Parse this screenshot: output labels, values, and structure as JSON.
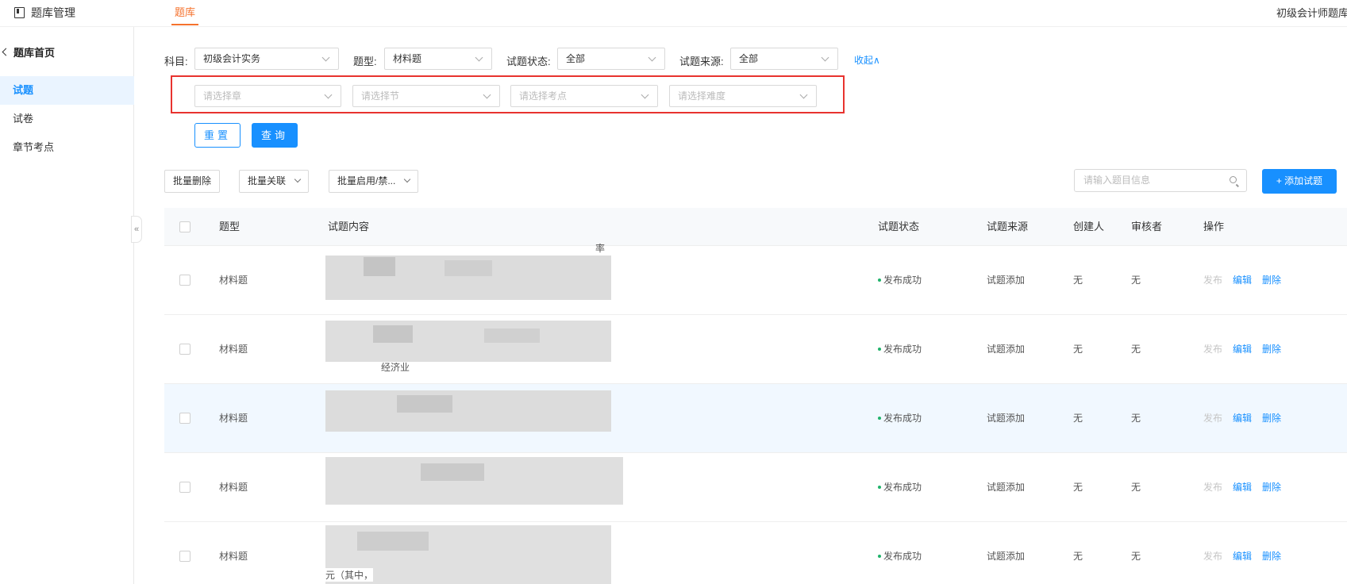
{
  "header": {
    "app_title": "题库管理",
    "active_tab": "题库",
    "right_text": "初级会计师题库"
  },
  "sidebar": {
    "back_label": "题库首页",
    "items": [
      {
        "label": "试题",
        "active": true
      },
      {
        "label": "试卷",
        "active": false
      },
      {
        "label": "章节考点",
        "active": false
      }
    ],
    "collapse_glyph": "«"
  },
  "filters": {
    "subject_label": "科目:",
    "subject_value": "初级会计实务",
    "type_label": "题型:",
    "type_value": "材料题",
    "status_label": "试题状态:",
    "status_value": "全部",
    "source_label": "试题来源:",
    "source_value": "全部",
    "collapse_link": "收起∧",
    "chapter_placeholder": "请选择章",
    "section_placeholder": "请选择节",
    "point_placeholder": "请选择考点",
    "difficulty_placeholder": "请选择难度"
  },
  "actions": {
    "reset": "重置",
    "query": "查询",
    "batch_delete": "批量删除",
    "batch_link": "批量关联",
    "batch_toggle": "批量启用/禁...",
    "search_placeholder": "请输入题目信息",
    "add_question": "+ 添加试题"
  },
  "table": {
    "columns": [
      "题型",
      "试题内容",
      "试题状态",
      "试题来源",
      "创建人",
      "审核者",
      "操作"
    ],
    "rows": [
      {
        "type": "材料题",
        "content": "",
        "status": "发布成功",
        "source": "试题添加",
        "creator": "无",
        "reviewer": "无",
        "ops": [
          "发布",
          "编辑",
          "删除"
        ]
      },
      {
        "type": "材料题",
        "content": "",
        "status": "发布成功",
        "source": "试题添加",
        "creator": "无",
        "reviewer": "无",
        "ops": [
          "发布",
          "编辑",
          "删除"
        ]
      },
      {
        "type": "材料题",
        "content": "",
        "status": "发布成功",
        "source": "试题添加",
        "creator": "无",
        "reviewer": "无",
        "ops": [
          "发布",
          "编辑",
          "删除"
        ]
      },
      {
        "type": "材料题",
        "content": "",
        "status": "发布成功",
        "source": "试题添加",
        "creator": "无",
        "reviewer": "无",
        "ops": [
          "发布",
          "编辑",
          "删除"
        ]
      },
      {
        "type": "材料题",
        "content": "",
        "status": "发布成功",
        "source": "试题添加",
        "creator": "无",
        "reviewer": "无",
        "ops": [
          "发布",
          "编辑",
          "删除"
        ]
      }
    ],
    "content_fragments": [
      "率",
      "经济业",
      "元（其中，"
    ]
  },
  "colors": {
    "primary": "#1890ff",
    "accent": "#f5722d",
    "status_green": "#20b36b",
    "highlight_red": "#e8332f"
  }
}
